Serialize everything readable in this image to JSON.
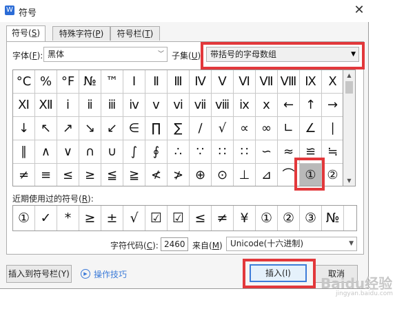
{
  "window": {
    "title": "符号",
    "close": "✕",
    "app_icon": "W"
  },
  "tabs": [
    {
      "label": "符号(",
      "key": "S",
      "suffix": ")"
    },
    {
      "label": "特殊字符(",
      "key": "P",
      "suffix": ")"
    },
    {
      "label": "符号栏(",
      "key": "T",
      "suffix": ")"
    }
  ],
  "font": {
    "label": "字体(",
    "key": "F",
    "suffix": "):",
    "value": "黑体"
  },
  "subset": {
    "label": "子集(",
    "key": "U",
    "suffix": ")",
    "value": "带括号的字母数组"
  },
  "symbols": [
    [
      "°C",
      "%",
      "°F",
      "№",
      "™",
      "Ⅰ",
      "Ⅱ",
      "Ⅲ",
      "Ⅳ",
      "Ⅴ",
      "Ⅵ",
      "Ⅶ",
      "Ⅷ",
      "Ⅸ",
      "Ⅹ"
    ],
    [
      "Ⅺ",
      "Ⅻ",
      "ⅰ",
      "ⅱ",
      "ⅲ",
      "ⅳ",
      "ⅴ",
      "ⅵ",
      "ⅶ",
      "ⅷ",
      "ⅸ",
      "ⅹ",
      "←",
      "↑",
      "→"
    ],
    [
      "↓",
      "↖",
      "↗",
      "↘",
      "↙",
      "∈",
      "∏",
      "∑",
      "∕",
      "√",
      "∝",
      "∞",
      "∟",
      "∠",
      "∣"
    ],
    [
      "∥",
      "∧",
      "∨",
      "∩",
      "∪",
      "∫",
      "∮",
      "∴",
      "∵",
      "∷",
      "∷",
      "∽",
      "≈",
      "≌",
      "≒"
    ],
    [
      "≠",
      "≡",
      "≤",
      "≥",
      "≦",
      "≧",
      "≮",
      "≯",
      "⊕",
      "⊙",
      "⊥",
      "⊿",
      "⌒",
      "①",
      "②"
    ]
  ],
  "selected_symbol": "①",
  "recent": {
    "label": "近期使用过的符号(",
    "key": "R",
    "suffix": "):",
    "items": [
      "①",
      "✓",
      "*",
      "≥",
      "±",
      "√",
      "☑",
      "☑",
      "≤",
      "≠",
      "¥",
      "①",
      "②",
      "③",
      "№"
    ]
  },
  "char_code": {
    "label": "字符代码(",
    "key": "C",
    "suffix": "):",
    "value": "2460"
  },
  "from": {
    "label": "来自(",
    "key": "M",
    "suffix": ")",
    "value": "Unicode(十六进制)"
  },
  "buttons": {
    "insert_to_bar": "插入到符号栏(Y)",
    "tips": "操作技巧",
    "insert": "插入(I)",
    "cancel": "取消"
  },
  "watermark": {
    "text": "Baidu经验",
    "sub": "jingyan.baidu.com"
  },
  "colors": {
    "highlight": "#e2383b",
    "accent": "#3c7bd8",
    "selected_cell": "#b9b9b9"
  }
}
